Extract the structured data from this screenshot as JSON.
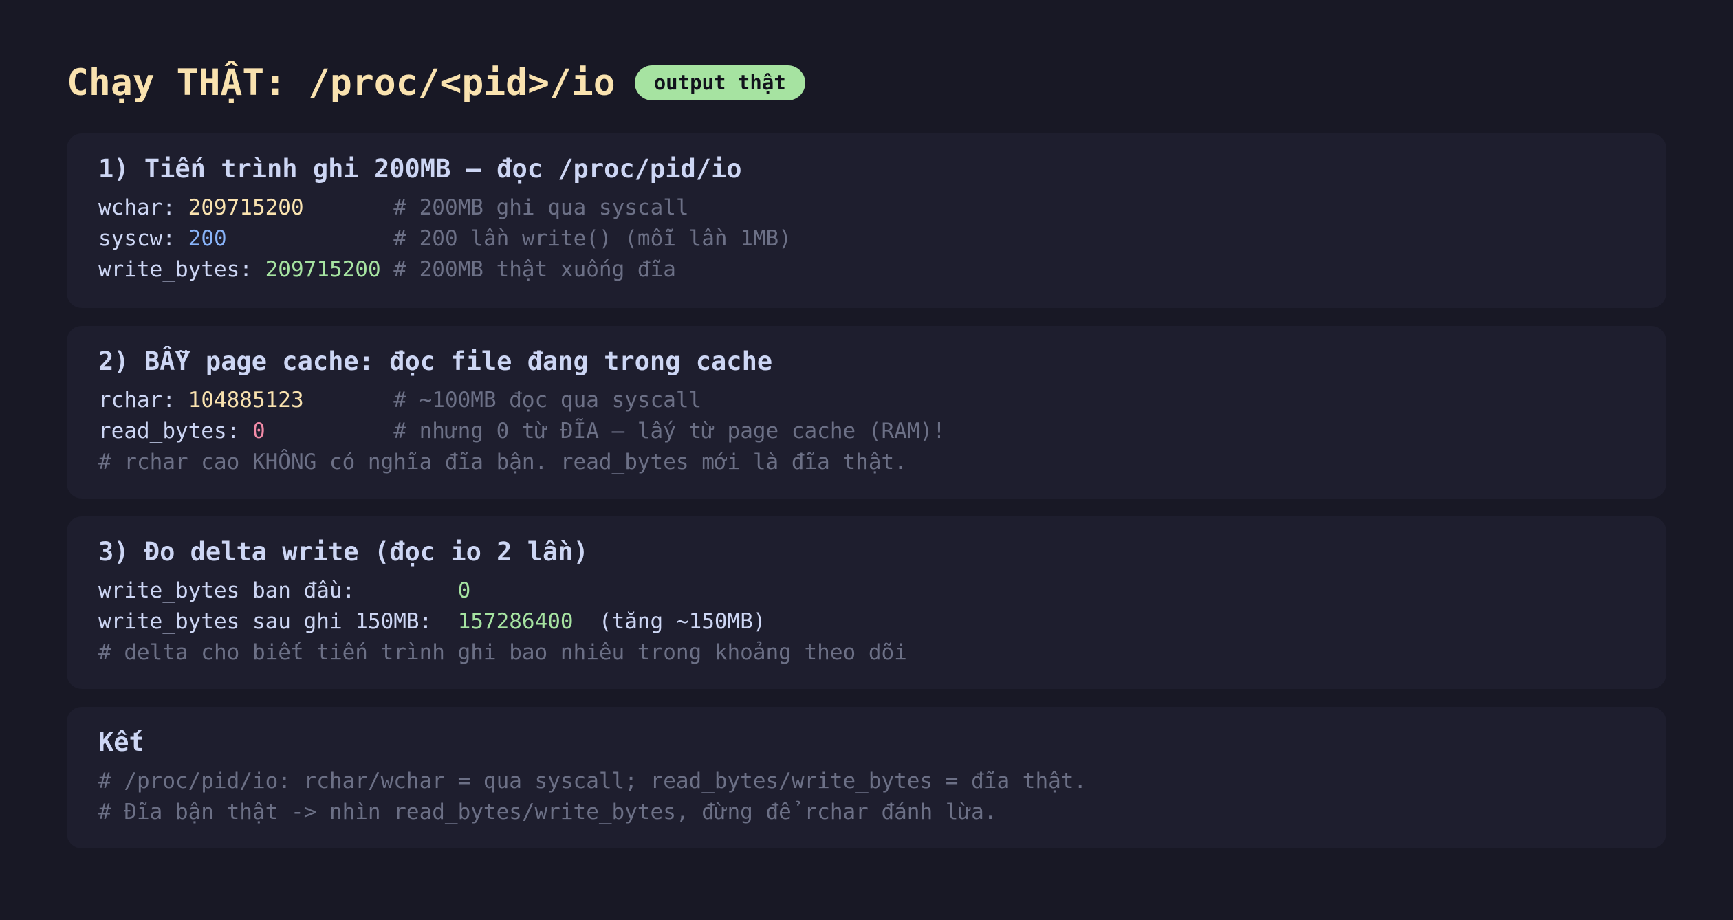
{
  "header": {
    "title": "Chạy THẬT: /proc/<pid>/io",
    "badge": "output thật"
  },
  "sections": [
    {
      "title": "1) Tiến trình ghi 200MB — đọc /proc/pid/io",
      "lines": [
        {
          "key": "wchar: ",
          "value": "209715200",
          "pad": "       ",
          "comment": "# 200MB ghi qua syscall"
        },
        {
          "key": "syscw: ",
          "value": "200",
          "pad": "             ",
          "comment": "# 200 lần write() (mỗi lần 1MB)"
        },
        {
          "key": "write_bytes: ",
          "value": "209715200",
          "pad": " ",
          "comment": "# 200MB thật xuống đĩa"
        }
      ]
    },
    {
      "title": "2) BẪY page cache: đọc file đang trong cache",
      "lines": [
        {
          "key": "rchar: ",
          "value": "104885123",
          "pad": "       ",
          "comment": "# ~100MB đọc qua syscall"
        },
        {
          "key": "read_bytes: ",
          "value": "0",
          "pad": "          ",
          "comment": "# nhưng 0 từ ĐĨA — lấy từ page cache (RAM)!"
        },
        {
          "comment": "# rchar cao KHÔNG có nghĩa đĩa bận. read_bytes mới là đĩa thật."
        }
      ]
    },
    {
      "title": "3) Đo delta write (đọc io 2 lần)",
      "lines": [
        {
          "key": "write_bytes ban đầu:        ",
          "value": "0"
        },
        {
          "key": "write_bytes sau ghi 150MB:  ",
          "value": "157286400",
          "suffix": "  (tăng ~150MB)"
        },
        {
          "comment": "# delta cho biết tiến trình ghi bao nhiêu trong khoảng theo dõi"
        }
      ]
    },
    {
      "title": "Kết",
      "lines": [
        {
          "comment": "# /proc/pid/io: rchar/wchar = qua syscall; read_bytes/write_bytes = đĩa thật."
        },
        {
          "comment": "# Đĩa bận thật -> nhìn read_bytes/write_bytes, đừng để rchar đánh lừa."
        }
      ]
    }
  ]
}
